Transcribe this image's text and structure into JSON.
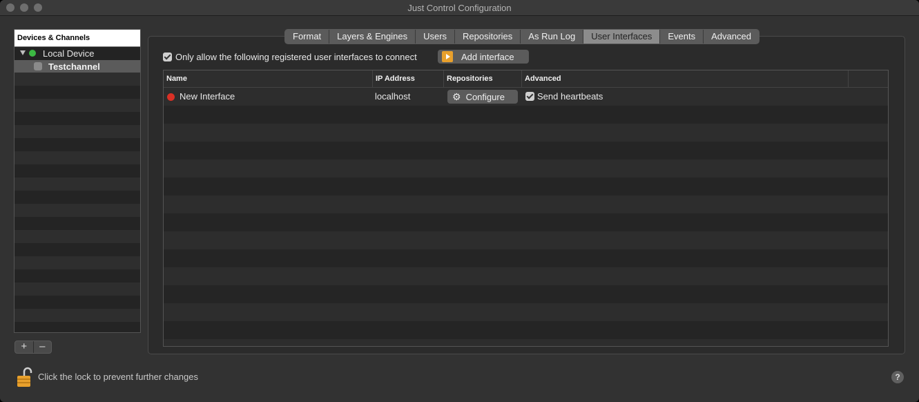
{
  "window": {
    "title": "Just Control Configuration"
  },
  "sidebar": {
    "header": "Devices & Channels",
    "device": {
      "label": "Local Device",
      "status_color": "#3cb843"
    },
    "channel": {
      "label": "Testchannel"
    },
    "add_label": "+",
    "remove_label": "–"
  },
  "tabs": [
    "Format",
    "Layers & Engines",
    "Users",
    "Repositories",
    "As Run Log",
    "User Interfaces",
    "Events",
    "Advanced"
  ],
  "active_tab": "User Interfaces",
  "ui_panel": {
    "allow_label": "Only allow the following registered user interfaces to connect",
    "allow_checked": true,
    "add_button": "Add interface"
  },
  "table": {
    "columns": [
      "Name",
      "IP Address",
      "Repositories",
      "Advanced"
    ],
    "rows": [
      {
        "status_color": "#d93025",
        "name": "New Interface",
        "ip": "localhost",
        "configure_label": "Configure",
        "heartbeat_label": "Send heartbeats",
        "heartbeat_checked": true
      }
    ]
  },
  "footer": {
    "lock_text": "Click the lock to prevent further changes",
    "help": "?"
  }
}
